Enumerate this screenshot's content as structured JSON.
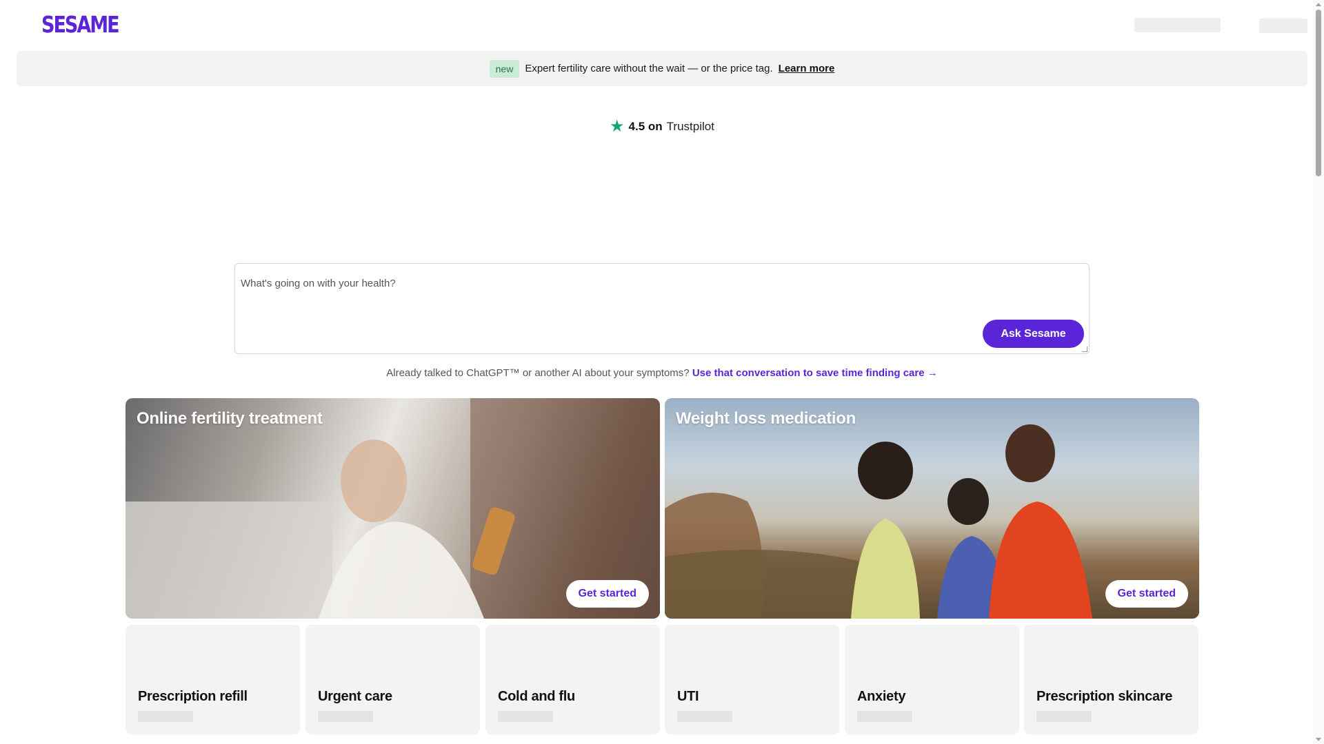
{
  "header": {
    "logo": "SESAME"
  },
  "banner": {
    "badge": "new",
    "text": "Expert fertility care without the wait — or the price tag.",
    "link": "Learn more"
  },
  "trustpilot": {
    "star_icon": "star-icon",
    "rating": "4.5 on",
    "brand": "Trustpilot"
  },
  "ask": {
    "placeholder": "What's going on with your health?",
    "button": "Ask Sesame"
  },
  "ai_prompt": {
    "text": "Already talked to ChatGPT™ or another AI about your symptoms?",
    "link": "Use that conversation to save time finding care →"
  },
  "features": [
    {
      "title": "Online fertility treatment",
      "button": "Get started"
    },
    {
      "title": "Weight loss medication",
      "button": "Get started"
    }
  ],
  "cards": [
    {
      "title": "Prescription refill"
    },
    {
      "title": "Urgent care"
    },
    {
      "title": "Cold and flu"
    },
    {
      "title": "UTI"
    },
    {
      "title": "Anxiety"
    },
    {
      "title": "Prescription skincare"
    }
  ],
  "colors": {
    "brand": "#5a24d9",
    "trust_green": "#1aa374",
    "badge_bg": "#c9ecd8"
  }
}
